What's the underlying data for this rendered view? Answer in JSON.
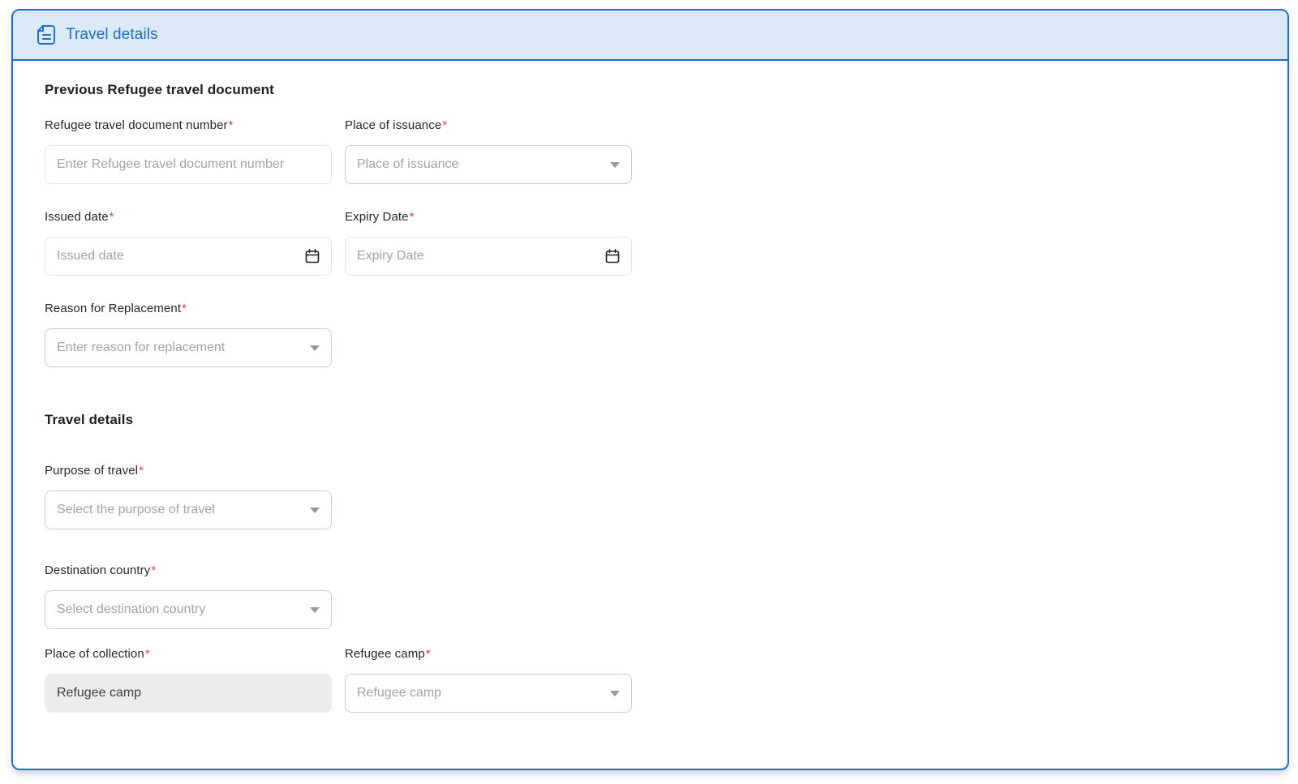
{
  "required_marker": "*",
  "colors": {
    "accent_blue": "#1a6fd4",
    "panel_border_blue": "#1c6cd7",
    "header_bg": "#dce9f8",
    "required_red": "#f5365c",
    "placeholder_gray": "#9fa3a9",
    "disabled_bg": "#ececee"
  },
  "header": {
    "title": "Travel details",
    "icon": "document-icon"
  },
  "previous_document_section": {
    "heading": "Previous Refugee travel document",
    "doc_number": {
      "label": "Refugee travel document number",
      "placeholder": "Enter Refugee travel document number",
      "value": ""
    },
    "place_of_issuance": {
      "label": "Place of issuance",
      "placeholder": "Place of issuance"
    },
    "issued_date": {
      "label": "Issued date",
      "placeholder": "Issued date",
      "value": "",
      "icon": "calendar-icon"
    },
    "expiry_date": {
      "label": "Expiry Date",
      "placeholder": "Expiry Date",
      "value": "",
      "icon": "calendar-icon"
    },
    "reason_for_replacement": {
      "label": "Reason for Replacement",
      "placeholder": "Enter reason for replacement"
    }
  },
  "travel_details_section": {
    "heading": "Travel details",
    "purpose_of_travel": {
      "label": "Purpose of travel",
      "placeholder": "Select the purpose of travel"
    },
    "destination_country": {
      "label": "Destination country",
      "placeholder": "Select destination country"
    },
    "place_of_collection": {
      "label": "Place of collection",
      "value": "Refugee camp",
      "disabled": true
    },
    "refugee_camp": {
      "label": "Refugee camp",
      "placeholder": "Refugee camp"
    }
  }
}
